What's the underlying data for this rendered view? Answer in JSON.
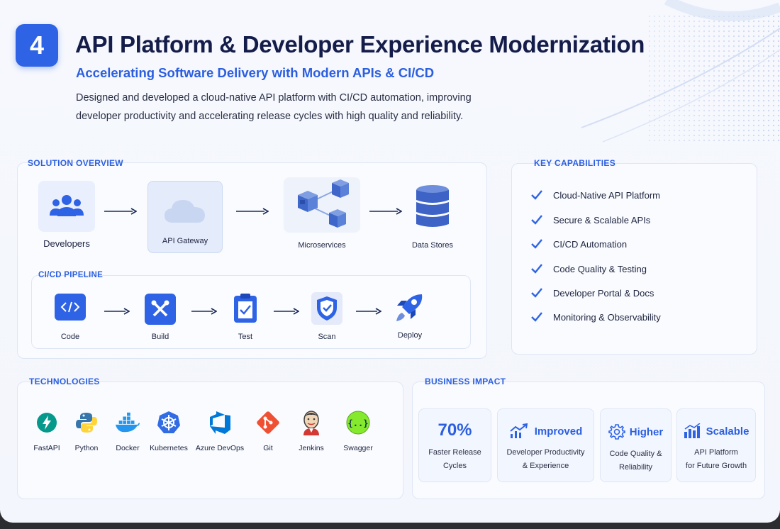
{
  "header": {
    "number": "4",
    "title": "API Platform & Developer Experience Modernization",
    "subtitle": "Accelerating Software Delivery with Modern APIs & CI/CD",
    "description": "Designed and developed a cloud-native API platform with CI/CD automation, improving developer productivity and accelerating release cycles with high quality and reliability."
  },
  "solution_overview": {
    "label": "SOLUTION OVERVIEW",
    "nodes": [
      {
        "label": "Developers",
        "icon": "users-icon"
      },
      {
        "label": "API Gateway",
        "icon": "cloud-icon"
      },
      {
        "label": "Microservices",
        "icon": "cubes-icon"
      },
      {
        "label": "Data Stores",
        "icon": "database-icon"
      }
    ]
  },
  "cicd": {
    "label": "CI/CD PIPELINE",
    "steps": [
      {
        "label": "Code",
        "icon": "code-icon"
      },
      {
        "label": "Build",
        "icon": "tools-icon"
      },
      {
        "label": "Test",
        "icon": "clipboard-check-icon"
      },
      {
        "label": "Scan",
        "icon": "shield-check-icon"
      },
      {
        "label": "Deploy",
        "icon": "rocket-icon"
      }
    ]
  },
  "capabilities": {
    "label": "KEY CAPABILITIES",
    "items": [
      "Cloud-Native API Platform",
      "Secure & Scalable APIs",
      "CI/CD Automation",
      "Code Quality & Testing",
      "Developer Portal & Docs",
      "Monitoring & Observability"
    ]
  },
  "technologies": {
    "label": "TECHNOLOGIES",
    "items": [
      {
        "label": "FastAPI",
        "icon": "fastapi-icon",
        "color": "#05998b"
      },
      {
        "label": "Python",
        "icon": "python-icon",
        "color": "#3776ab"
      },
      {
        "label": "Docker",
        "icon": "docker-icon",
        "color": "#2496ed"
      },
      {
        "label": "Kubernetes",
        "icon": "kubernetes-icon",
        "color": "#326ce5"
      },
      {
        "label": "Azure DevOps",
        "icon": "azure-devops-icon",
        "color": "#0078d7"
      },
      {
        "label": "Git",
        "icon": "git-icon",
        "color": "#f05032"
      },
      {
        "label": "Jenkins",
        "icon": "jenkins-icon",
        "color": "#d33833"
      },
      {
        "label": "Swagger",
        "icon": "swagger-icon",
        "color": "#85ea2d"
      }
    ]
  },
  "impact": {
    "label": "BUSINESS IMPACT",
    "items": [
      {
        "head": "70%",
        "line1": "Faster Release",
        "line2": "Cycles",
        "icon": ""
      },
      {
        "head": "Improved",
        "line1": "Developer Productivity",
        "line2": "& Experience",
        "icon": "trend-up-icon"
      },
      {
        "head": "Higher",
        "line1": "Code Quality &",
        "line2": "Reliability",
        "icon": "gear-icon"
      },
      {
        "head": "Scalable",
        "line1": "API Platform",
        "line2": "for Future Growth",
        "icon": "bar-chart-icon"
      }
    ]
  },
  "colors": {
    "accent": "#2e63e6",
    "title": "#141c4a",
    "panel_border": "#dfe6f4"
  }
}
